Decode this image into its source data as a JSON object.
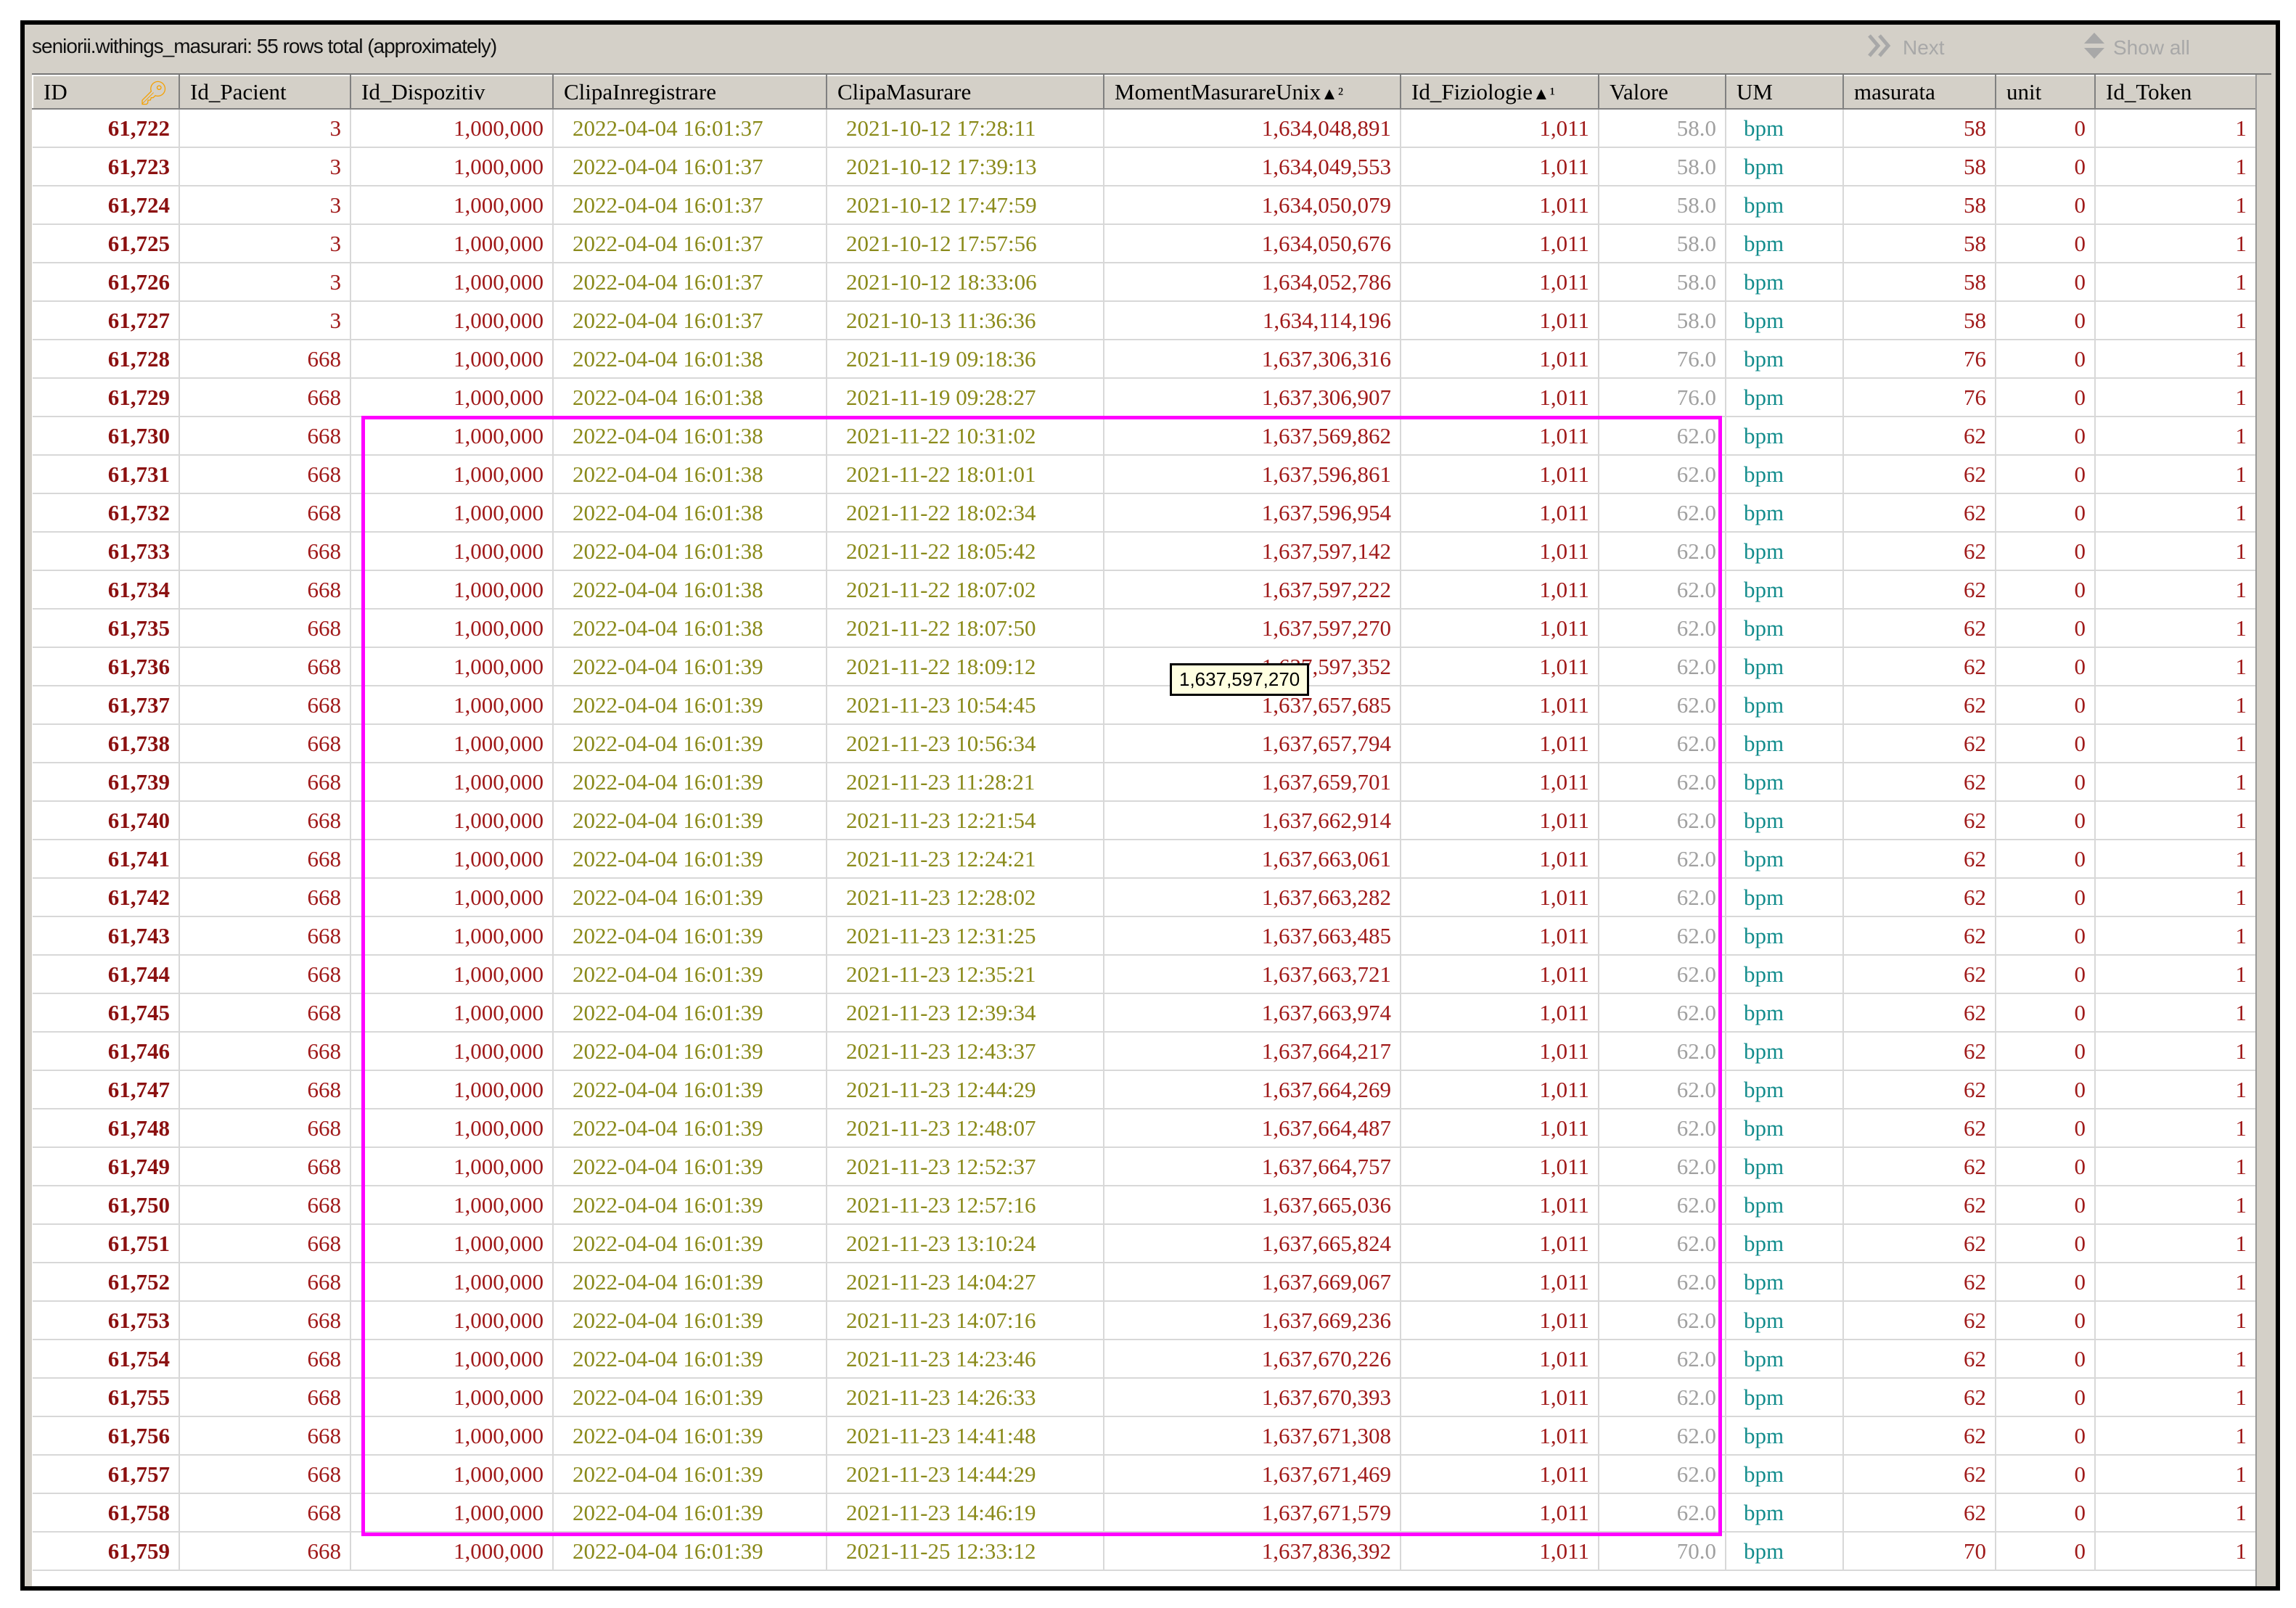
{
  "window": {
    "title": "seniorii.withings_masurari: 55 rows total (approximately)",
    "next_label": "Next",
    "show_all_label": "Show all"
  },
  "columns": [
    "ID",
    "Id_Pacient",
    "Id_Dispozitiv",
    "ClipaInregistrare",
    "ClipaMasurare",
    "MomentMasurareUnix",
    "Id_Fiziologie",
    "Valore",
    "UM",
    "masurata",
    "unit",
    "Id_Token"
  ],
  "sort_indicators": {
    "MomentMasurareUnix": "▲²",
    "Id_Fiziologie": "▲¹"
  },
  "tooltip": "1,637,597,270",
  "highlight_color": "#ff00ff",
  "rows": [
    [
      "61,722",
      "3",
      "1,000,000",
      "2022-04-04 16:01:37",
      "2021-10-12 17:28:11",
      "1,634,048,891",
      "1,011",
      "58.0",
      "bpm",
      "58",
      "0",
      "1"
    ],
    [
      "61,723",
      "3",
      "1,000,000",
      "2022-04-04 16:01:37",
      "2021-10-12 17:39:13",
      "1,634,049,553",
      "1,011",
      "58.0",
      "bpm",
      "58",
      "0",
      "1"
    ],
    [
      "61,724",
      "3",
      "1,000,000",
      "2022-04-04 16:01:37",
      "2021-10-12 17:47:59",
      "1,634,050,079",
      "1,011",
      "58.0",
      "bpm",
      "58",
      "0",
      "1"
    ],
    [
      "61,725",
      "3",
      "1,000,000",
      "2022-04-04 16:01:37",
      "2021-10-12 17:57:56",
      "1,634,050,676",
      "1,011",
      "58.0",
      "bpm",
      "58",
      "0",
      "1"
    ],
    [
      "61,726",
      "3",
      "1,000,000",
      "2022-04-04 16:01:37",
      "2021-10-12 18:33:06",
      "1,634,052,786",
      "1,011",
      "58.0",
      "bpm",
      "58",
      "0",
      "1"
    ],
    [
      "61,727",
      "3",
      "1,000,000",
      "2022-04-04 16:01:37",
      "2021-10-13 11:36:36",
      "1,634,114,196",
      "1,011",
      "58.0",
      "bpm",
      "58",
      "0",
      "1"
    ],
    [
      "61,728",
      "668",
      "1,000,000",
      "2022-04-04 16:01:38",
      "2021-11-19 09:18:36",
      "1,637,306,316",
      "1,011",
      "76.0",
      "bpm",
      "76",
      "0",
      "1"
    ],
    [
      "61,729",
      "668",
      "1,000,000",
      "2022-04-04 16:01:38",
      "2021-11-19 09:28:27",
      "1,637,306,907",
      "1,011",
      "76.0",
      "bpm",
      "76",
      "0",
      "1"
    ],
    [
      "61,730",
      "668",
      "1,000,000",
      "2022-04-04 16:01:38",
      "2021-11-22 10:31:02",
      "1,637,569,862",
      "1,011",
      "62.0",
      "bpm",
      "62",
      "0",
      "1"
    ],
    [
      "61,731",
      "668",
      "1,000,000",
      "2022-04-04 16:01:38",
      "2021-11-22 18:01:01",
      "1,637,596,861",
      "1,011",
      "62.0",
      "bpm",
      "62",
      "0",
      "1"
    ],
    [
      "61,732",
      "668",
      "1,000,000",
      "2022-04-04 16:01:38",
      "2021-11-22 18:02:34",
      "1,637,596,954",
      "1,011",
      "62.0",
      "bpm",
      "62",
      "0",
      "1"
    ],
    [
      "61,733",
      "668",
      "1,000,000",
      "2022-04-04 16:01:38",
      "2021-11-22 18:05:42",
      "1,637,597,142",
      "1,011",
      "62.0",
      "bpm",
      "62",
      "0",
      "1"
    ],
    [
      "61,734",
      "668",
      "1,000,000",
      "2022-04-04 16:01:38",
      "2021-11-22 18:07:02",
      "1,637,597,222",
      "1,011",
      "62.0",
      "bpm",
      "62",
      "0",
      "1"
    ],
    [
      "61,735",
      "668",
      "1,000,000",
      "2022-04-04 16:01:38",
      "2021-11-22 18:07:50",
      "1,637,597,270",
      "1,011",
      "62.0",
      "bpm",
      "62",
      "0",
      "1"
    ],
    [
      "61,736",
      "668",
      "1,000,000",
      "2022-04-04 16:01:39",
      "2021-11-22 18:09:12",
      "1,637,597,352",
      "1,011",
      "62.0",
      "bpm",
      "62",
      "0",
      "1"
    ],
    [
      "61,737",
      "668",
      "1,000,000",
      "2022-04-04 16:01:39",
      "2021-11-23 10:54:45",
      "1,637,657,685",
      "1,011",
      "62.0",
      "bpm",
      "62",
      "0",
      "1"
    ],
    [
      "61,738",
      "668",
      "1,000,000",
      "2022-04-04 16:01:39",
      "2021-11-23 10:56:34",
      "1,637,657,794",
      "1,011",
      "62.0",
      "bpm",
      "62",
      "0",
      "1"
    ],
    [
      "61,739",
      "668",
      "1,000,000",
      "2022-04-04 16:01:39",
      "2021-11-23 11:28:21",
      "1,637,659,701",
      "1,011",
      "62.0",
      "bpm",
      "62",
      "0",
      "1"
    ],
    [
      "61,740",
      "668",
      "1,000,000",
      "2022-04-04 16:01:39",
      "2021-11-23 12:21:54",
      "1,637,662,914",
      "1,011",
      "62.0",
      "bpm",
      "62",
      "0",
      "1"
    ],
    [
      "61,741",
      "668",
      "1,000,000",
      "2022-04-04 16:01:39",
      "2021-11-23 12:24:21",
      "1,637,663,061",
      "1,011",
      "62.0",
      "bpm",
      "62",
      "0",
      "1"
    ],
    [
      "61,742",
      "668",
      "1,000,000",
      "2022-04-04 16:01:39",
      "2021-11-23 12:28:02",
      "1,637,663,282",
      "1,011",
      "62.0",
      "bpm",
      "62",
      "0",
      "1"
    ],
    [
      "61,743",
      "668",
      "1,000,000",
      "2022-04-04 16:01:39",
      "2021-11-23 12:31:25",
      "1,637,663,485",
      "1,011",
      "62.0",
      "bpm",
      "62",
      "0",
      "1"
    ],
    [
      "61,744",
      "668",
      "1,000,000",
      "2022-04-04 16:01:39",
      "2021-11-23 12:35:21",
      "1,637,663,721",
      "1,011",
      "62.0",
      "bpm",
      "62",
      "0",
      "1"
    ],
    [
      "61,745",
      "668",
      "1,000,000",
      "2022-04-04 16:01:39",
      "2021-11-23 12:39:34",
      "1,637,663,974",
      "1,011",
      "62.0",
      "bpm",
      "62",
      "0",
      "1"
    ],
    [
      "61,746",
      "668",
      "1,000,000",
      "2022-04-04 16:01:39",
      "2021-11-23 12:43:37",
      "1,637,664,217",
      "1,011",
      "62.0",
      "bpm",
      "62",
      "0",
      "1"
    ],
    [
      "61,747",
      "668",
      "1,000,000",
      "2022-04-04 16:01:39",
      "2021-11-23 12:44:29",
      "1,637,664,269",
      "1,011",
      "62.0",
      "bpm",
      "62",
      "0",
      "1"
    ],
    [
      "61,748",
      "668",
      "1,000,000",
      "2022-04-04 16:01:39",
      "2021-11-23 12:48:07",
      "1,637,664,487",
      "1,011",
      "62.0",
      "bpm",
      "62",
      "0",
      "1"
    ],
    [
      "61,749",
      "668",
      "1,000,000",
      "2022-04-04 16:01:39",
      "2021-11-23 12:52:37",
      "1,637,664,757",
      "1,011",
      "62.0",
      "bpm",
      "62",
      "0",
      "1"
    ],
    [
      "61,750",
      "668",
      "1,000,000",
      "2022-04-04 16:01:39",
      "2021-11-23 12:57:16",
      "1,637,665,036",
      "1,011",
      "62.0",
      "bpm",
      "62",
      "0",
      "1"
    ],
    [
      "61,751",
      "668",
      "1,000,000",
      "2022-04-04 16:01:39",
      "2021-11-23 13:10:24",
      "1,637,665,824",
      "1,011",
      "62.0",
      "bpm",
      "62",
      "0",
      "1"
    ],
    [
      "61,752",
      "668",
      "1,000,000",
      "2022-04-04 16:01:39",
      "2021-11-23 14:04:27",
      "1,637,669,067",
      "1,011",
      "62.0",
      "bpm",
      "62",
      "0",
      "1"
    ],
    [
      "61,753",
      "668",
      "1,000,000",
      "2022-04-04 16:01:39",
      "2021-11-23 14:07:16",
      "1,637,669,236",
      "1,011",
      "62.0",
      "bpm",
      "62",
      "0",
      "1"
    ],
    [
      "61,754",
      "668",
      "1,000,000",
      "2022-04-04 16:01:39",
      "2021-11-23 14:23:46",
      "1,637,670,226",
      "1,011",
      "62.0",
      "bpm",
      "62",
      "0",
      "1"
    ],
    [
      "61,755",
      "668",
      "1,000,000",
      "2022-04-04 16:01:39",
      "2021-11-23 14:26:33",
      "1,637,670,393",
      "1,011",
      "62.0",
      "bpm",
      "62",
      "0",
      "1"
    ],
    [
      "61,756",
      "668",
      "1,000,000",
      "2022-04-04 16:01:39",
      "2021-11-23 14:41:48",
      "1,637,671,308",
      "1,011",
      "62.0",
      "bpm",
      "62",
      "0",
      "1"
    ],
    [
      "61,757",
      "668",
      "1,000,000",
      "2022-04-04 16:01:39",
      "2021-11-23 14:44:29",
      "1,637,671,469",
      "1,011",
      "62.0",
      "bpm",
      "62",
      "0",
      "1"
    ],
    [
      "61,758",
      "668",
      "1,000,000",
      "2022-04-04 16:01:39",
      "2021-11-23 14:46:19",
      "1,637,671,579",
      "1,011",
      "62.0",
      "bpm",
      "62",
      "0",
      "1"
    ],
    [
      "61,759",
      "668",
      "1,000,000",
      "2022-04-04 16:01:39",
      "2021-11-25 12:33:12",
      "1,637,836,392",
      "1,011",
      "70.0",
      "bpm",
      "70",
      "0",
      "1"
    ]
  ]
}
